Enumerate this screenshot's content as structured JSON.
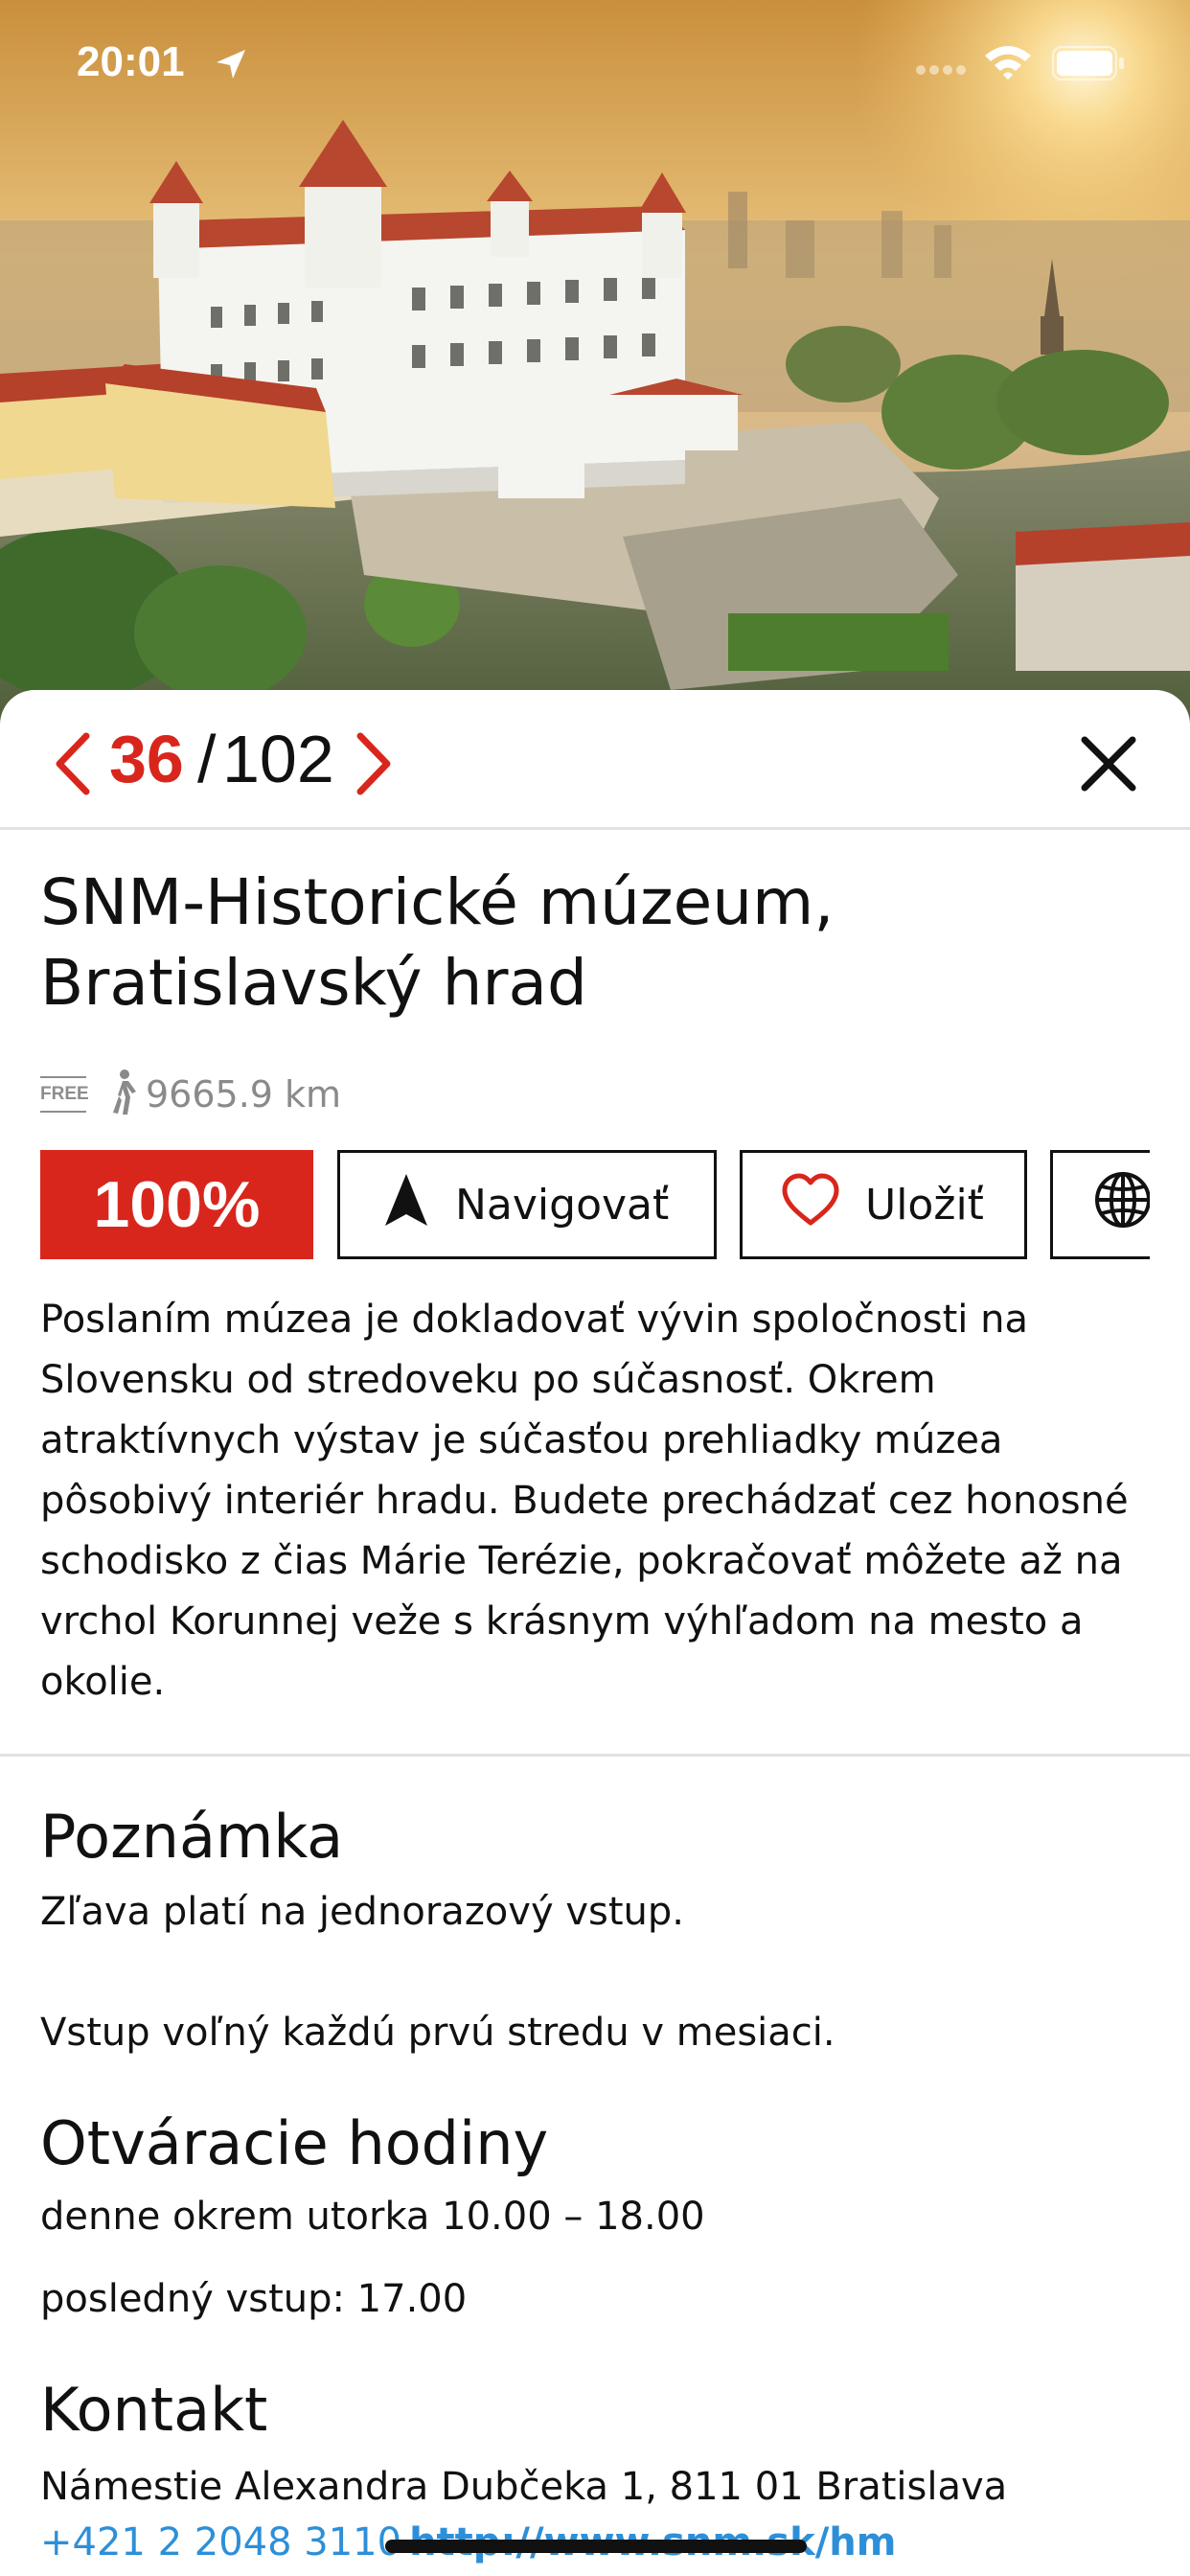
{
  "status_bar": {
    "time": "20:01"
  },
  "hero": {
    "image_description": ""
  },
  "pager": {
    "current": "36",
    "separator": "/",
    "total": "102"
  },
  "poi": {
    "title": "SNM-Historické múzeum, Bratislavský hrad",
    "price_badge": "FREE",
    "distance": "9665.9 km",
    "rating_percent": "100%",
    "actions": {
      "navigate_label": "Navigovať",
      "save_label": "Uložiť"
    },
    "description": "Poslaním múzea je dokladovať vývin spoločnosti na Slovensku od stredoveku po súčasnosť. Okrem atraktívnych výstav je súčasťou prehliadky múzea pôsobivý interiér hradu. Budete prechádzať cez honosné schodisko z čias Márie Terézie, pokračovať môžete až na vrchol Korunnej veže s krásnym výhľadom na mesto a okolie."
  },
  "note": {
    "heading": "Poznámka",
    "line1": "Zľava platí na jednorazový vstup.",
    "line2": "Vstup voľný každú prvú stredu v mesiaci."
  },
  "hours": {
    "heading": "Otváracie hodiny",
    "line1": "denne okrem utorka 10.00 – 18.00",
    "line2": "posledný vstup: 17.00"
  },
  "contact": {
    "heading": "Kontakt",
    "address": "Námestie Alexandra Dubčeka 1, 811 01 Bratislava",
    "phone": "+421 2 2048 3110",
    "web": "http://www.snm.sk/hm"
  },
  "colors": {
    "accent": "#d9261c",
    "link": "#2d8fd8",
    "muted": "#8a8a8a"
  }
}
